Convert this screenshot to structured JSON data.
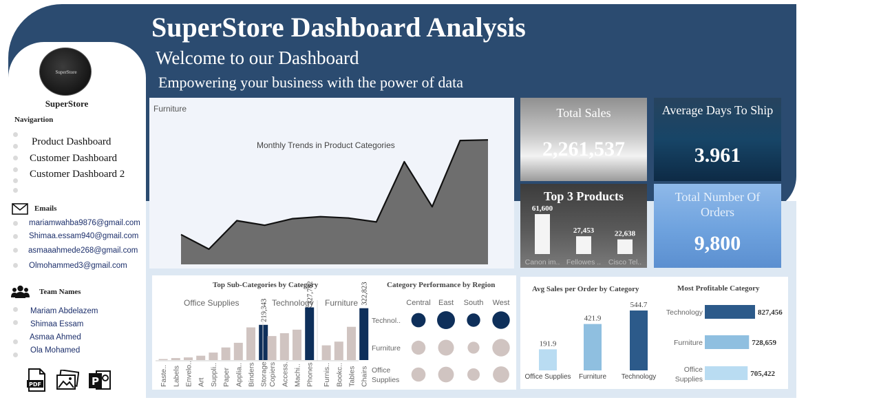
{
  "header": {
    "title": "SuperStore Dashboard Analysis",
    "welcome": "Welcome to our Dashboard",
    "tagline": "Empowering your business with the power of data"
  },
  "sidebar": {
    "logo_text": "SuperStore",
    "brand": "SuperStore",
    "nav_title": "Navigartion",
    "nav_items": [
      "Product Dashboard",
      "Customer Dashboard",
      "Customer Dashboard 2"
    ],
    "emails_title": "Emails",
    "emails": [
      "mariamwahba9876@gmail.com",
      "Shimaa.essam940@gmail.com",
      "asmaaahmede268@gmail.com",
      "Olmohammed3@gmail.com"
    ],
    "team_title": "Team Names",
    "team": [
      "Mariam Abdelazem",
      "Shimaa Essam",
      "Asmaa Ahmed",
      "Ola Mohamed"
    ],
    "export_icons": [
      "pdf-icon",
      "image-icon",
      "powerpoint-icon"
    ]
  },
  "kpis": {
    "total_sales_label": "Total Sales",
    "total_sales_value": "2,261,537",
    "avg_days_label": "Average Days To Ship",
    "avg_days_value": "3.961",
    "top3_label": "Top 3 Products",
    "orders_label": "Total Number Of Orders",
    "orders_value": "9,800"
  },
  "colors": {
    "header": "#2b4b70",
    "accent_dark": "#0e2f5a",
    "bar_beige": "#d0c4c1",
    "light_blue": "#b9dcf2",
    "mid_blue": "#8fbfe0",
    "dark_blue": "#2c5a8a"
  },
  "chart_data": [
    {
      "type": "area",
      "filter_label": "Furniture",
      "title": "Monthly Trends in Product Categories",
      "x": [
        1,
        2,
        3,
        4,
        5,
        6,
        7,
        8,
        9,
        10,
        11,
        12
      ],
      "values": [
        45,
        23,
        66,
        59,
        69,
        72,
        70,
        64,
        155,
        87,
        187,
        188
      ],
      "ylim": [
        0,
        210
      ]
    },
    {
      "type": "bar",
      "title": "Top 3 Products",
      "categories": [
        "Canon im..",
        "Fellowes ..",
        "Cisco Tel.."
      ],
      "values": [
        61600,
        27453,
        22638
      ],
      "value_labels": [
        "61,600",
        "27,453",
        "22,638"
      ]
    },
    {
      "type": "bar",
      "title": "Top Sub-Categories by Category",
      "groups": [
        {
          "name": "Office Supplies",
          "categories": [
            "Faste..",
            "Labels",
            "Envelo..",
            "Art",
            "Suppli..",
            "Paper",
            "Applia..",
            "Binders",
            "Storage"
          ],
          "values": [
            3024,
            12486,
            16476,
            27119,
            46674,
            78479,
            107532,
            203413,
            219343
          ],
          "highlight": "Storage",
          "highlight_label": "219,343"
        },
        {
          "name": "Technology",
          "categories": [
            "Copiers",
            "Access..",
            "Machi..",
            "Phones"
          ],
          "values": [
            149528,
            167380,
            189239,
            327782
          ],
          "highlight": "Phones",
          "highlight_label": "327,782"
        },
        {
          "name": "Furniture",
          "categories": [
            "Furnis..",
            "Bookc..",
            "Tables",
            "Chairs"
          ],
          "values": [
            91705,
            114880,
            206966,
            322823
          ],
          "highlight": "Chairs",
          "highlight_label": "322,823"
        }
      ],
      "ylim": [
        0,
        360000
      ]
    },
    {
      "type": "scatter",
      "title": "Category Performance by Region",
      "regions": [
        "Central",
        "East",
        "South",
        "West"
      ],
      "categories": [
        "Technol..",
        "Furniture",
        "Office Supplies"
      ],
      "values": [
        [
          170416,
          264974,
          148772,
          251992
        ],
        [
          163797,
          208291,
          117299,
          252613
        ],
        [
          167026,
          205516,
          125651,
          220853
        ]
      ]
    },
    {
      "type": "bar",
      "title": "Avg Sales per Order by Category",
      "categories": [
        "Office Supplies",
        "Furniture",
        "Technology"
      ],
      "values": [
        191.9,
        421.9,
        544.7
      ],
      "value_labels": [
        "191.9",
        "421.9",
        "544.7"
      ],
      "colors": [
        "#b9dcf2",
        "#8fbfe0",
        "#2c5a8a"
      ]
    },
    {
      "type": "bar",
      "orientation": "horizontal",
      "title": "Most Profitable Category",
      "categories": [
        "Technology",
        "Furniture",
        "Office Supplies"
      ],
      "values": [
        827456,
        728659,
        705422
      ],
      "value_labels": [
        "827,456",
        "728,659",
        "705,422"
      ],
      "colors": [
        "#2c5a8a",
        "#8fbfe0",
        "#b9dcf2"
      ]
    }
  ]
}
